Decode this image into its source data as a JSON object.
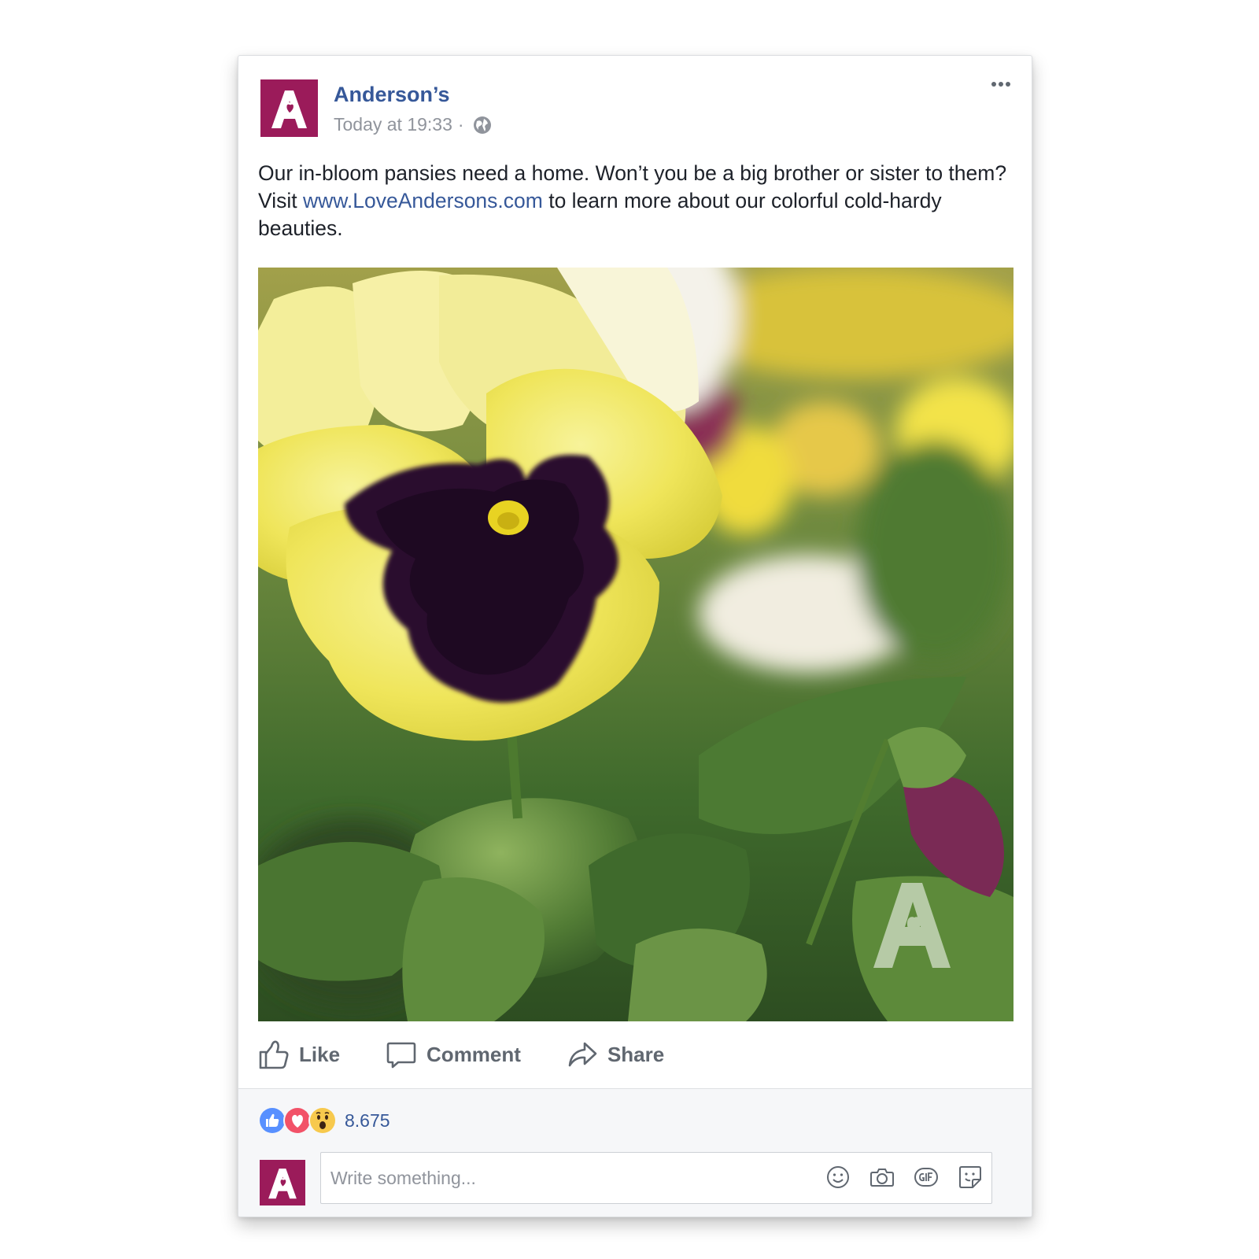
{
  "post": {
    "page_name": "Anderson’s",
    "timestamp": "Today at 19:33",
    "separator": "·",
    "caption_before_link": "Our in-bloom pansies need a home. Won’t you be a big brother or sister to them? Visit ",
    "caption_link": "www.LoveAndersons.com",
    "caption_after_link": " to learn more about our colorful cold-hardy beauties.",
    "privacy_icon": "globe-icon",
    "menu_icon": "more-options-icon",
    "brand_color": "#9b1b5a",
    "link_color": "#365899"
  },
  "actions": {
    "like_label": "Like",
    "comment_label": "Comment",
    "share_label": "Share"
  },
  "reactions": {
    "types": [
      "like",
      "love",
      "wow"
    ],
    "count": "8.675"
  },
  "comment": {
    "placeholder": "Write something...",
    "tools": [
      "emoji-icon",
      "camera-icon",
      "gif-icon",
      "sticker-icon"
    ]
  }
}
